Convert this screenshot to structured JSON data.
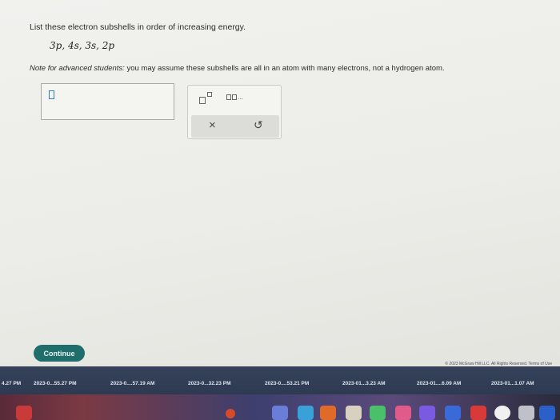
{
  "question": {
    "prompt": "List these electron subshells in order of increasing energy.",
    "subshells": "3p, 4s, 3s, 2p",
    "note_lead": "Note for advanced students:",
    "note_rest": " you may assume these subshells are all in an atom with many electrons, not a hydrogen atom."
  },
  "toolbar": {
    "superscript_icon": "superscript-box-icon",
    "sequence_icon": "sequence-boxes-icon",
    "clear_label": "×",
    "undo_label": "↺"
  },
  "footer": {
    "continue_label": "Continue",
    "copyright": "© 2023 McGraw Hill LLC. All Rights Reserved.   Terms of Use"
  },
  "taskbar": {
    "items": [
      "4.27 PM",
      "2023-0...55.27 PM",
      "2023-0....57.19 AM",
      "2023-0...32.23 PM",
      "2023-0....53.21 PM",
      "2023-01...3.23 AM",
      "2023-01....6.09 AM",
      "2023-01...1.07 AM"
    ]
  },
  "colors": {
    "continue_bg": "#1f6e6c",
    "cursor": "#3a78c6",
    "taskbar_bg": "#2d3a52"
  }
}
